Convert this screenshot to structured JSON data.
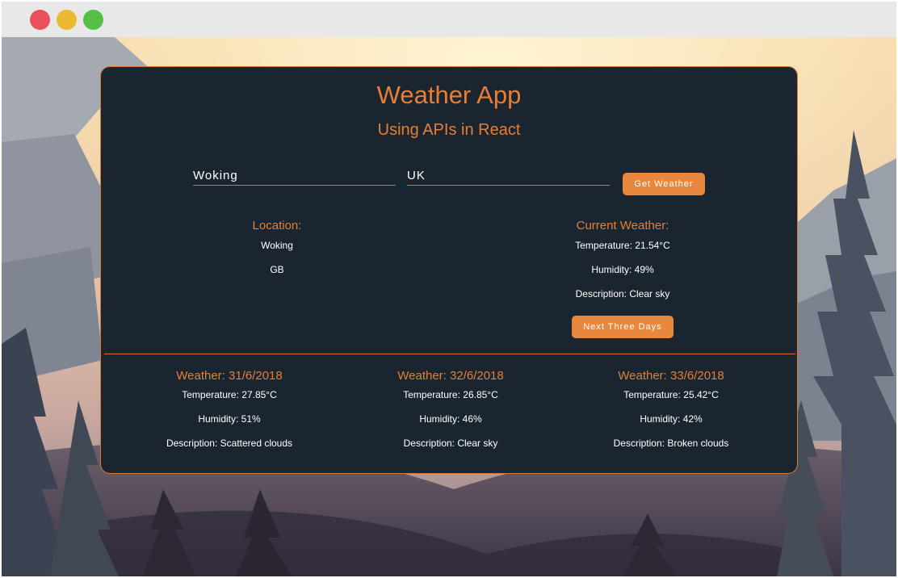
{
  "app": {
    "title": "Weather App",
    "subtitle": "Using APIs in React"
  },
  "form": {
    "city_value": "Woking",
    "country_value": "UK",
    "get_weather_label": "Get Weather"
  },
  "location": {
    "heading": "Location:",
    "city": "Woking",
    "country": "GB"
  },
  "current": {
    "heading": "Current Weather:",
    "temperature": "Temperature: 21.54°C",
    "humidity": "Humidity: 49%",
    "description": "Description: Clear sky",
    "next_button_label": "Next Three Days"
  },
  "forecast": [
    {
      "heading": "Weather: 31/6/2018",
      "temperature": "Temperature: 27.85°C",
      "humidity": "Humidity: 51%",
      "description": "Description: Scattered clouds"
    },
    {
      "heading": "Weather: 32/6/2018",
      "temperature": "Temperature: 26.85°C",
      "humidity": "Humidity: 46%",
      "description": "Description: Clear sky"
    },
    {
      "heading": "Weather: 33/6/2018",
      "temperature": "Temperature: 25.42°C",
      "humidity": "Humidity: 42%",
      "description": "Description: Broken clouds"
    }
  ],
  "colors": {
    "accent": "#e57f35",
    "card_background": "#1b2530",
    "button": "#e8873e"
  }
}
